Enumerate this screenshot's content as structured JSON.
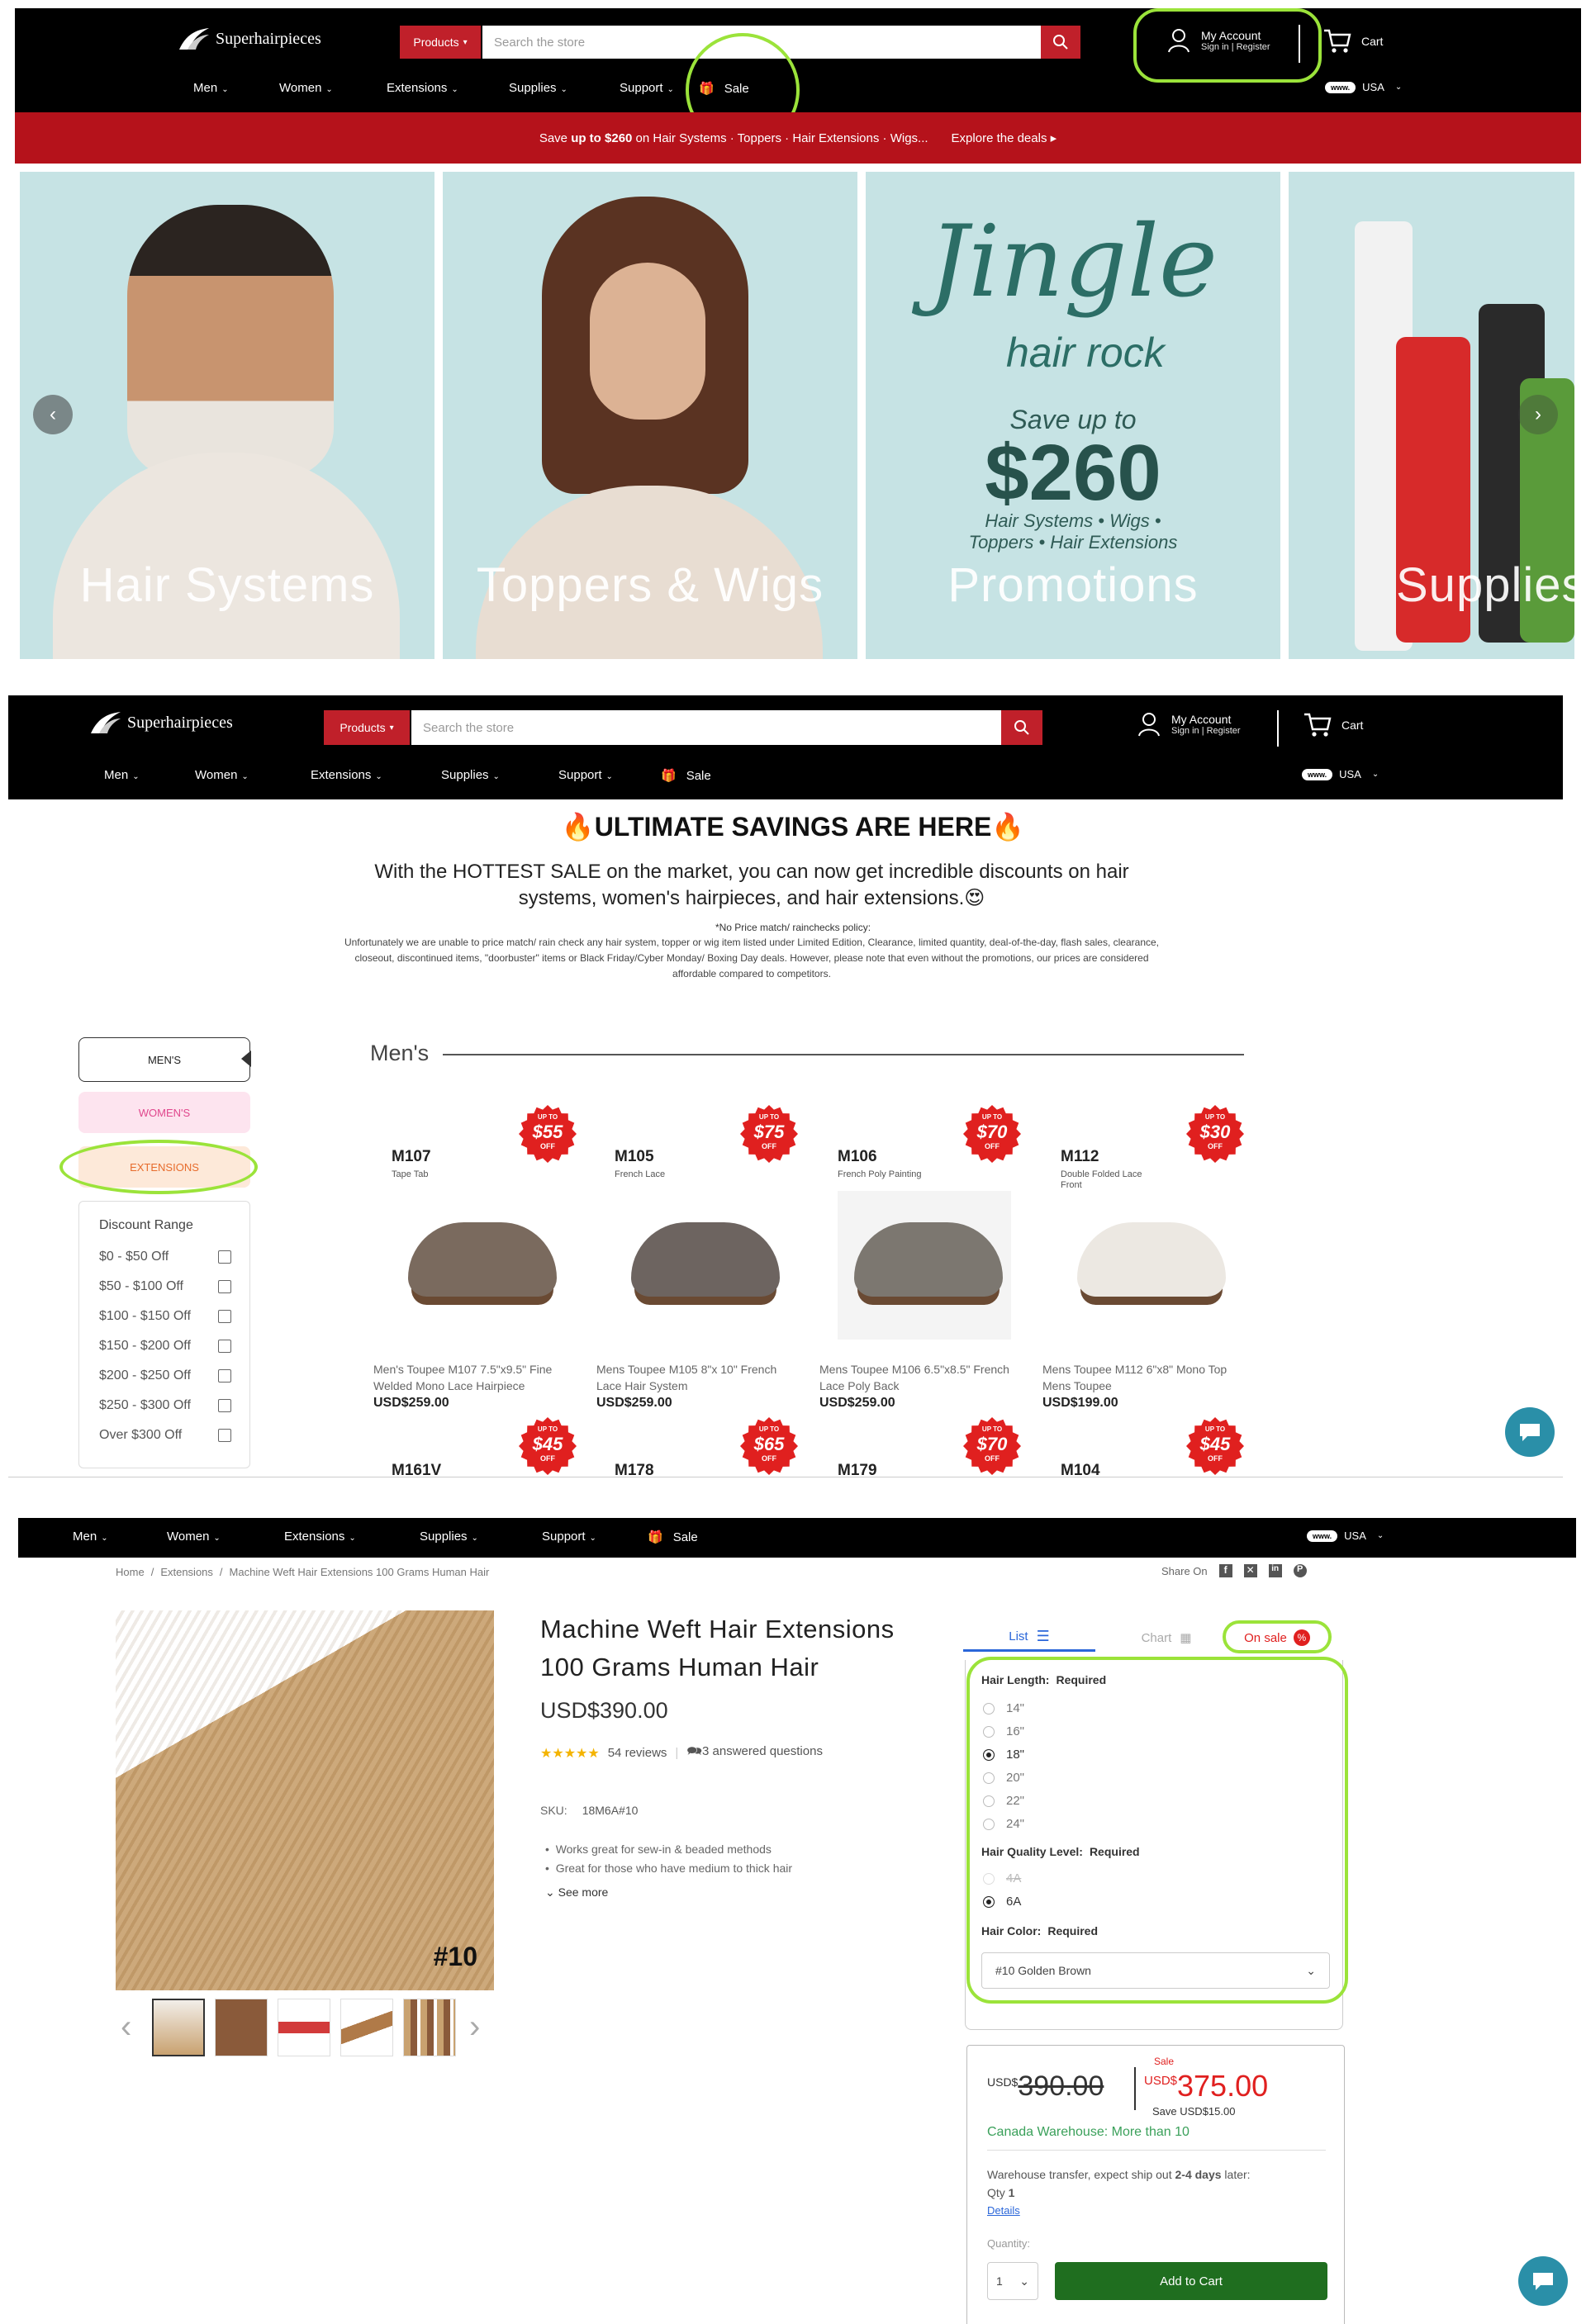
{
  "brand": {
    "name": "Superhairpieces"
  },
  "header": {
    "products_label": "Products",
    "search_placeholder": "Search the store",
    "account_title": "My Account",
    "account_sub": "Sign in | Register",
    "cart_label": "Cart",
    "nav": [
      "Men",
      "Women",
      "Extensions",
      "Supplies",
      "Support"
    ],
    "sale_label": "Sale",
    "region_pill": "www.",
    "region_label": "USA"
  },
  "promo_bar": {
    "text_pre": "Save ",
    "text_bold": "up to $260",
    "text_post": " on Hair Systems · Toppers · Hair Extensions · Wigs...",
    "link": "Explore the deals"
  },
  "hero": {
    "tiles": [
      "Hair Systems",
      "Toppers & Wigs",
      "Promotions",
      "Supplies"
    ],
    "jingle_title": "Jingle",
    "jingle_sub": "hair rock",
    "save_text": "Save up to",
    "save_amount": "$260",
    "save_lines": [
      "Hair Systems • Wigs •",
      "Toppers • Hair Extensions"
    ]
  },
  "sale_page": {
    "title": "🔥ULTIMATE SAVINGS ARE HERE🔥",
    "intro": "With the HOTTEST SALE on the market, you can now get incredible discounts on hair systems, women's hairpieces, and hair extensions.😍",
    "policy_title": "*No Price match/ rainchecks policy:",
    "policy_text": "Unfortunately we are unable to price match/ rain check any hair system, topper or wig item listed under Limited Edition, Clearance, limited quantity, deal-of-the-day, flash sales, clearance, closeout, discontinued items, \"doorbuster\" items or Black Friday/Cyber Monday/ Boxing Day deals. However, please note that even without the promotions, our prices are considered affordable compared to competitors.",
    "side_buttons": [
      "MEN'S",
      "WOMEN'S",
      "EXTENSIONS"
    ],
    "filter_title": "Discount Range",
    "filter_options": [
      "$0 - $50 Off",
      "$50 - $100 Off",
      "$100 - $150 Off",
      "$150 - $200 Off",
      "$200 - $250 Off",
      "$250 - $300 Off",
      "Over $300 Off"
    ],
    "section_title": "Men's",
    "products": [
      {
        "code": "M107",
        "sub": "Tape Tab",
        "badge": "$55",
        "name": "Men's Toupee M107 7.5\"x9.5\" Fine Welded Mono Lace Hairpiece",
        "price": "USD$259.00"
      },
      {
        "code": "M105",
        "sub": "French Lace",
        "badge": "$75",
        "name": "Mens Toupee M105 8\"x 10\" French Lace Hair System",
        "price": "USD$259.00"
      },
      {
        "code": "M106",
        "sub": "French Poly Painting",
        "badge": "$70",
        "name": "Mens Toupee M106 6.5\"x8.5\" French Lace Poly Back",
        "price": "USD$259.00"
      },
      {
        "code": "M112",
        "sub": "Double Folded Lace Front",
        "badge": "$30",
        "name": "Mens Toupee M112 6\"x8\" Mono Top Mens Toupee",
        "price": "USD$199.00"
      }
    ],
    "products_row2": [
      {
        "code": "M161V",
        "badge": "$45"
      },
      {
        "code": "M178",
        "badge": "$65"
      },
      {
        "code": "M179",
        "badge": "$70"
      },
      {
        "code": "M104",
        "badge": "$45"
      }
    ],
    "badge_up": "UP TO",
    "badge_off": "OFF"
  },
  "product_page": {
    "breadcrumb": [
      "Home",
      "Extensions",
      "Machine Weft Hair Extensions 100 Grams Human Hair"
    ],
    "share_label": "Share On",
    "title": "Machine Weft Hair Extensions 100 Grams Human Hair",
    "price": "USD$390.00",
    "stars": "★★★★★",
    "reviews": "54 reviews",
    "questions": "3 answered questions",
    "sku_label": "SKU:",
    "sku": "18M6A#10",
    "bullets": [
      "Works great for sew-in & beaded methods",
      "Great for those who have medium to thick hair"
    ],
    "see_more": "See more",
    "image_label": "#10",
    "view_list": "List",
    "view_chart": "Chart",
    "on_sale": "On sale",
    "length_label": "Hair Length:",
    "required": "Required",
    "lengths": [
      "14\"",
      "16\"",
      "18\"",
      "20\"",
      "22\"",
      "24\""
    ],
    "length_selected": "18\"",
    "quality_label": "Hair Quality Level:",
    "qualities": [
      "4A",
      "6A"
    ],
    "quality_selected": "6A",
    "color_label": "Hair Color:",
    "color_value": "#10 Golden Brown",
    "old_currency": "USD$",
    "old_price": "390.00",
    "sale_tag": "Sale",
    "new_currency": "USD$",
    "new_price": "375.00",
    "save_text": "Save USD$15.00",
    "warehouse": "Canada Warehouse: More than 10",
    "ship_pre": "Warehouse transfer, expect ship out ",
    "ship_bold": "2-4 days",
    "ship_post": " later:",
    "qty_label": "Qty",
    "qty_value": "1",
    "details": "Details",
    "quantity_label": "Quantity:",
    "quantity_value": "1",
    "add_to_cart": "Add to Cart"
  },
  "colors": {
    "brand_red": "#c0202a",
    "highlight": "#9be33a",
    "add_to_cart": "#1f6e1f",
    "sale_red": "#e0201f",
    "teal": "#2a8fa8"
  }
}
